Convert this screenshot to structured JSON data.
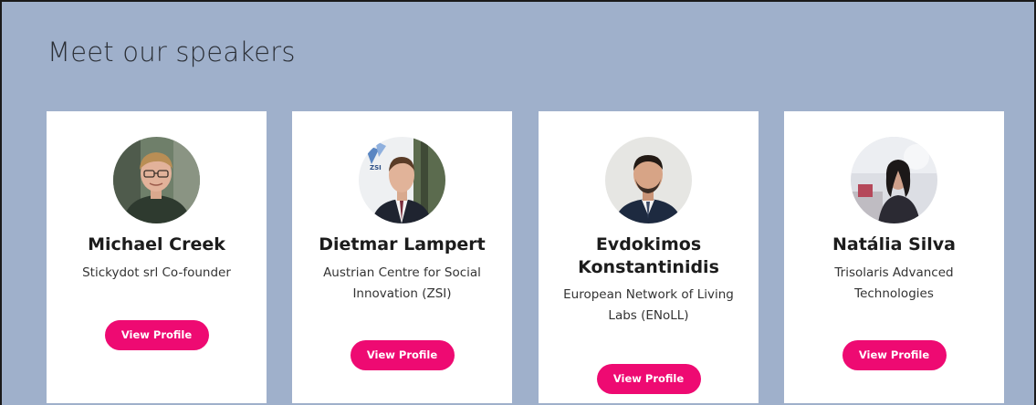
{
  "section": {
    "title": "Meet our speakers"
  },
  "speakers": [
    {
      "name": "Michael Creek",
      "organization": "Stickydot srl Co-founder",
      "button_label": "View Profile",
      "photo_icon": "speaker-photo-icon"
    },
    {
      "name": "Dietmar Lampert",
      "organization": "Austrian Centre for Social Innovation (ZSI)",
      "button_label": "View Profile",
      "photo_icon": "speaker-photo-icon",
      "photo_logo_text": "ZSI"
    },
    {
      "name": "Evdokimos Konstantinidis",
      "organization": "European Network of Living Labs (ENoLL)",
      "button_label": "View Profile",
      "photo_icon": "speaker-photo-icon"
    },
    {
      "name": "Natália Silva",
      "organization": "Trisolaris Advanced Technologies",
      "button_label": "View Profile",
      "photo_icon": "speaker-photo-icon"
    }
  ],
  "colors": {
    "section_background": "#9fb0cb",
    "card_background": "#ffffff",
    "button_accent": "#ee0a72",
    "button_text": "#ffffff",
    "heading_text": "#1c1c1c"
  }
}
